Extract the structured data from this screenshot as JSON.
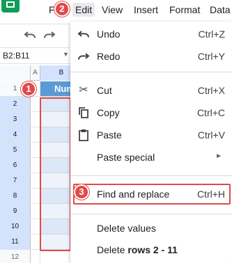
{
  "menubar": {
    "items": [
      {
        "label": "File"
      },
      {
        "label": "Edit"
      },
      {
        "label": "View"
      },
      {
        "label": "Insert"
      },
      {
        "label": "Format"
      },
      {
        "label": "Data"
      }
    ]
  },
  "toolbar": {
    "icons": [
      "undo-icon",
      "redo-icon"
    ]
  },
  "name_box": {
    "value": "B2:B11"
  },
  "grid": {
    "columns": [
      "A",
      "B"
    ],
    "rows": [
      "1",
      "2",
      "3",
      "4",
      "5",
      "6",
      "7",
      "8",
      "9",
      "10",
      "11",
      "12"
    ],
    "header_cell": "Num"
  },
  "markers": [
    "1",
    "2",
    "3"
  ],
  "edit_menu": {
    "items": [
      {
        "label": "Undo",
        "shortcut": "Ctrl+Z",
        "icon": "undo-icon"
      },
      {
        "label": "Redo",
        "shortcut": "Ctrl+Y",
        "icon": "redo-icon"
      },
      {
        "label": "Cut",
        "shortcut": "Ctrl+X",
        "icon": "scissors-icon"
      },
      {
        "label": "Copy",
        "shortcut": "Ctrl+C",
        "icon": "copy-icon"
      },
      {
        "label": "Paste",
        "shortcut": "Ctrl+V",
        "icon": "clipboard-icon"
      },
      {
        "label": "Paste special",
        "shortcut": "",
        "icon": "chevron-right-icon"
      },
      {
        "label": "Find and replace",
        "shortcut": "Ctrl+H",
        "icon": ""
      },
      {
        "label": "Delete values",
        "shortcut": "",
        "icon": ""
      },
      {
        "label_prefix": "Delete ",
        "label_bold": "rows 2 - 11",
        "shortcut": "",
        "icon": ""
      }
    ]
  },
  "colors": {
    "accent_red": "#e04a4a",
    "header_blue": "#5b9bd5",
    "selection_blue": "#d3e3fd",
    "sheets_green": "#0f9d58"
  }
}
